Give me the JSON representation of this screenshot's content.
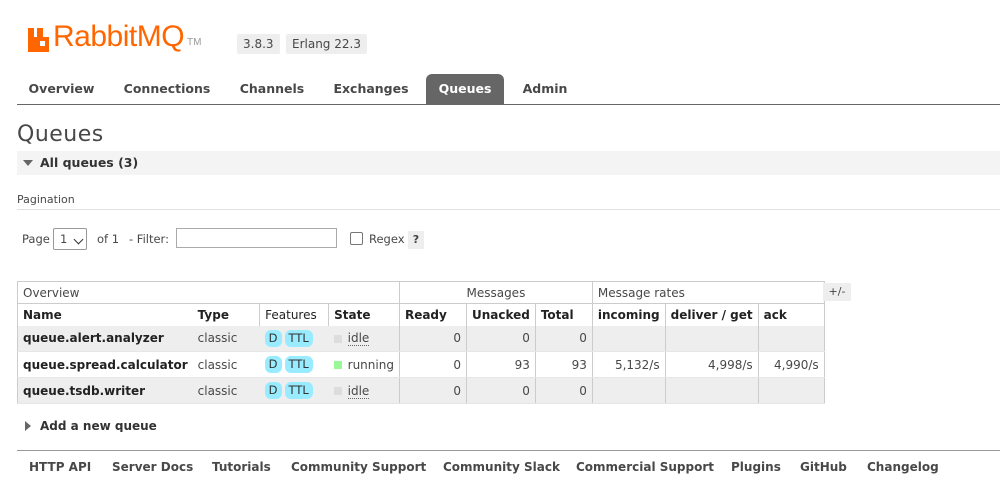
{
  "header": {
    "brand_word": "RabbitMQ",
    "tm": "TM",
    "version": "3.8.3",
    "erlang": "Erlang 22.3",
    "brand_color": "#ff6600"
  },
  "nav": {
    "tabs": [
      {
        "label": "Overview"
      },
      {
        "label": "Connections"
      },
      {
        "label": "Channels"
      },
      {
        "label": "Exchanges"
      },
      {
        "label": "Queues",
        "active": true
      },
      {
        "label": "Admin"
      }
    ]
  },
  "page": {
    "title": "Queues",
    "section_label": "All queues (3)"
  },
  "pagination": {
    "title": "Pagination",
    "page_label": "Page",
    "page_value": "1",
    "of_label": "of 1",
    "filter_label": "- Filter:",
    "filter_value": "",
    "regex_label": "Regex",
    "help_label": "?"
  },
  "table": {
    "groups": [
      "Overview",
      "Messages",
      "Message rates"
    ],
    "columns": [
      "Name",
      "Type",
      "Features",
      "State",
      "Ready",
      "Unacked",
      "Total",
      "incoming",
      "deliver / get",
      "ack"
    ],
    "cols_button": "+/-",
    "rows": [
      {
        "name": "queue.alert.analyzer",
        "type": "classic",
        "features": [
          "D",
          "TTL"
        ],
        "state": "idle",
        "ready": "0",
        "unacked": "0",
        "total": "0",
        "incoming": "",
        "deliver": "",
        "ack": ""
      },
      {
        "name": "queue.spread.calculator",
        "type": "classic",
        "features": [
          "D",
          "TTL"
        ],
        "state": "running",
        "ready": "0",
        "unacked": "93",
        "total": "93",
        "incoming": "5,132/s",
        "deliver": "4,998/s",
        "ack": "4,990/s"
      },
      {
        "name": "queue.tsdb.writer",
        "type": "classic",
        "features": [
          "D",
          "TTL"
        ],
        "state": "idle",
        "ready": "0",
        "unacked": "0",
        "total": "0",
        "incoming": "",
        "deliver": "",
        "ack": ""
      }
    ],
    "state_colors": {
      "idle": "#dddddd",
      "running": "#98f898"
    },
    "feature_color": "#99ebff"
  },
  "add_queue": {
    "label": "Add a new queue"
  },
  "footer": {
    "links": [
      "HTTP API",
      "Server Docs",
      "Tutorials",
      "Community Support",
      "Community Slack",
      "Commercial Support",
      "Plugins",
      "GitHub",
      "Changelog"
    ]
  }
}
